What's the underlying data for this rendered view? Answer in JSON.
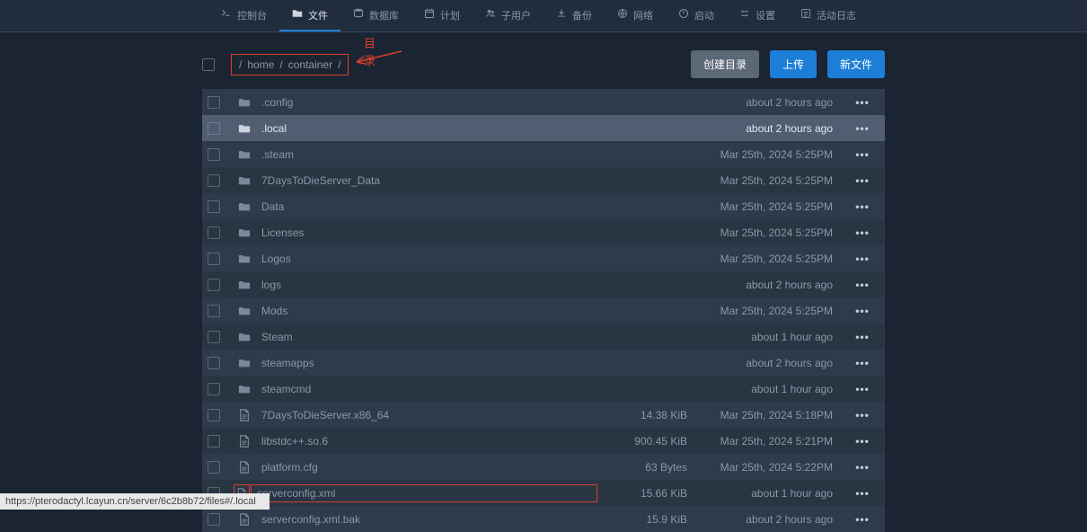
{
  "nav": {
    "tabs": [
      {
        "id": "console",
        "label": "控制台"
      },
      {
        "id": "files",
        "label": "文件",
        "active": true
      },
      {
        "id": "database",
        "label": "数据库"
      },
      {
        "id": "schedule",
        "label": "计划"
      },
      {
        "id": "subusers",
        "label": "子用户"
      },
      {
        "id": "backup",
        "label": "备份"
      },
      {
        "id": "network",
        "label": "网络"
      },
      {
        "id": "startup",
        "label": "启动"
      },
      {
        "id": "settings",
        "label": "设置"
      },
      {
        "id": "activity",
        "label": "活动日志"
      }
    ]
  },
  "breadcrumb": {
    "parts": [
      "/",
      "home",
      "/",
      "container",
      "/"
    ],
    "annotation": "目录"
  },
  "buttons": {
    "mkdir": "创建目录",
    "upload": "上传",
    "newfile": "新文件"
  },
  "files": [
    {
      "type": "dir",
      "name": ".config",
      "size": "",
      "date": "about 2 hours ago"
    },
    {
      "type": "dir",
      "name": ".local",
      "size": "",
      "date": "about 2 hours ago",
      "highlight": true
    },
    {
      "type": "dir",
      "name": ".steam",
      "size": "",
      "date": "Mar 25th, 2024 5:25PM"
    },
    {
      "type": "dir",
      "name": "7DaysToDieServer_Data",
      "size": "",
      "date": "Mar 25th, 2024 5:25PM"
    },
    {
      "type": "dir",
      "name": "Data",
      "size": "",
      "date": "Mar 25th, 2024 5:25PM"
    },
    {
      "type": "dir",
      "name": "Licenses",
      "size": "",
      "date": "Mar 25th, 2024 5:25PM"
    },
    {
      "type": "dir",
      "name": "Logos",
      "size": "",
      "date": "Mar 25th, 2024 5:25PM"
    },
    {
      "type": "dir",
      "name": "logs",
      "size": "",
      "date": "about 2 hours ago"
    },
    {
      "type": "dir",
      "name": "Mods",
      "size": "",
      "date": "Mar 25th, 2024 5:25PM"
    },
    {
      "type": "dir",
      "name": "Steam",
      "size": "",
      "date": "about 1 hour ago"
    },
    {
      "type": "dir",
      "name": "steamapps",
      "size": "",
      "date": "about 2 hours ago"
    },
    {
      "type": "dir",
      "name": "steamcmd",
      "size": "",
      "date": "about 1 hour ago"
    },
    {
      "type": "file",
      "name": "7DaysToDieServer.x86_64",
      "size": "14.38 KiB",
      "date": "Mar 25th, 2024 5:18PM"
    },
    {
      "type": "file",
      "name": "libstdc++.so.6",
      "size": "900.45 KiB",
      "date": "Mar 25th, 2024 5:21PM"
    },
    {
      "type": "file",
      "name": "platform.cfg",
      "size": "63 Bytes",
      "date": "Mar 25th, 2024 5:22PM"
    },
    {
      "type": "file",
      "name": "serverconfig.xml",
      "size": "15.66 KiB",
      "date": "about 1 hour ago",
      "nameBoxed": true,
      "iconBoxed": true
    },
    {
      "type": "file",
      "name": "serverconfig.xml.bak",
      "size": "15.9 KiB",
      "date": "about 2 hours ago"
    }
  ],
  "statusbar": "https://pterodactyl.lcayun.cn/server/6c2b8b72/files#/.local"
}
